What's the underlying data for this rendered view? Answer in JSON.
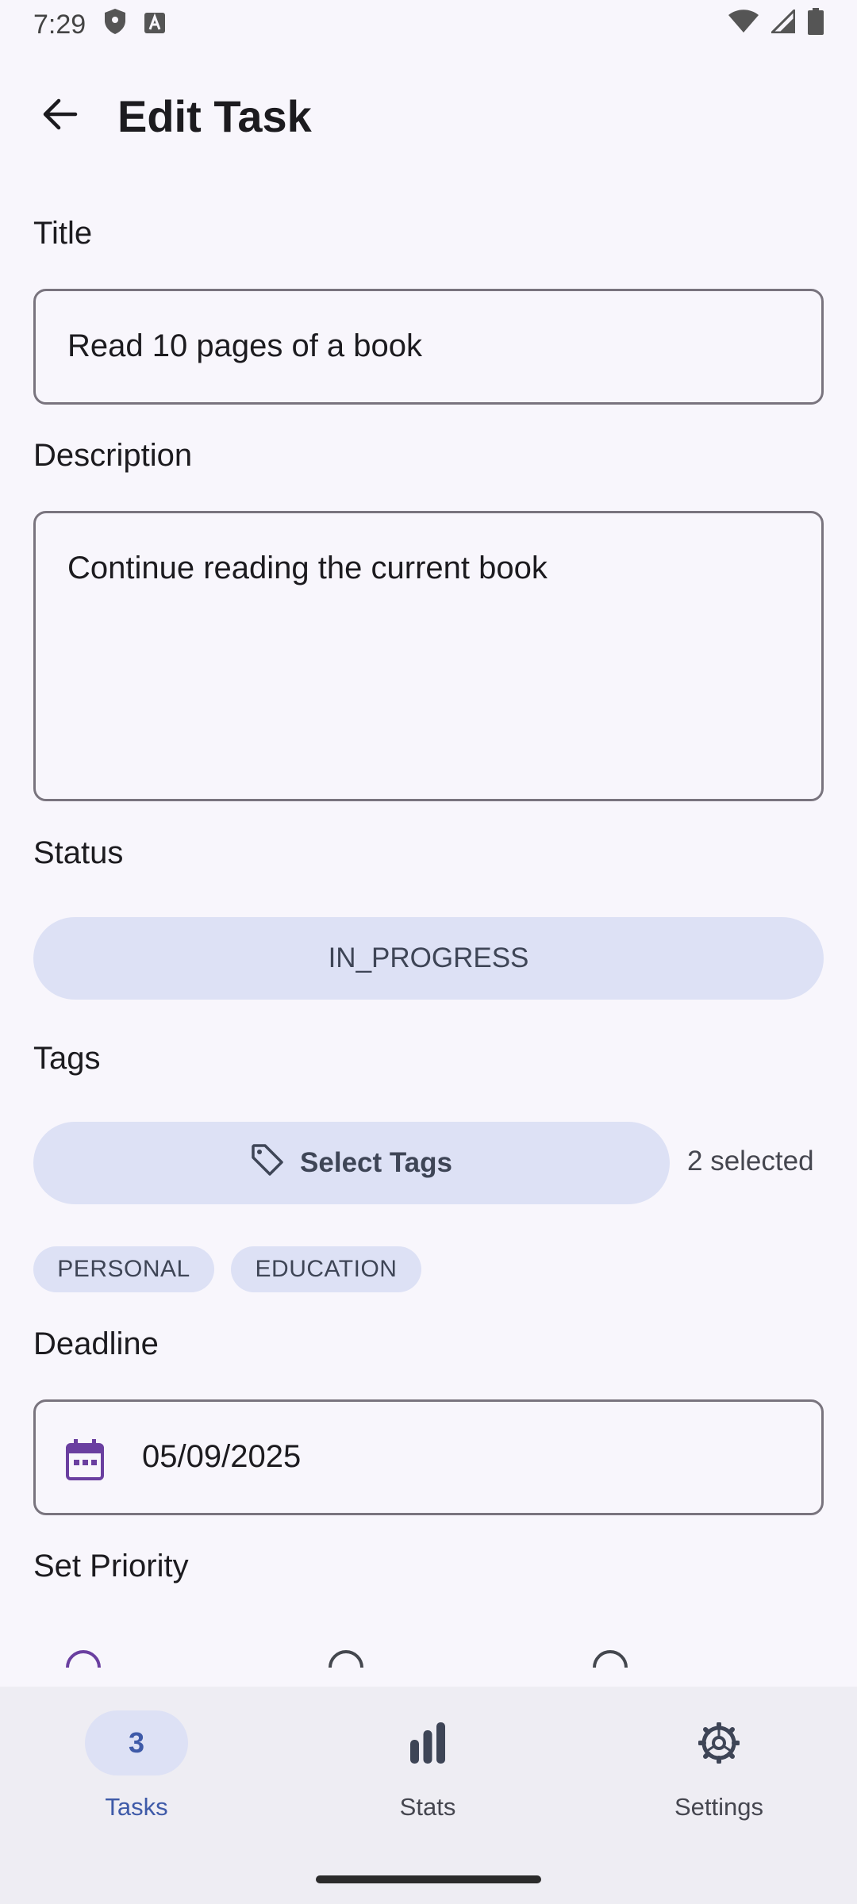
{
  "status_bar": {
    "time": "7:29"
  },
  "app_bar": {
    "title": "Edit Task"
  },
  "form": {
    "title_label": "Title",
    "title_value": "Read 10 pages of a book",
    "description_label": "Description",
    "description_value": "Continue reading the current book",
    "status_label": "Status",
    "status_value": "IN_PROGRESS",
    "tags_label": "Tags",
    "select_tags_label": "Select Tags",
    "tags_selected_count": "2 selected",
    "tags": [
      "PERSONAL",
      "EDUCATION"
    ],
    "deadline_label": "Deadline",
    "deadline_value": "05/09/2025",
    "priority_label": "Set Priority"
  },
  "bottom_nav": {
    "items": [
      {
        "label": "Tasks",
        "badge": "3",
        "active": true
      },
      {
        "label": "Stats",
        "active": false
      },
      {
        "label": "Settings",
        "active": false
      }
    ]
  },
  "colors": {
    "background": "#F8F6FC",
    "tonal_container": "#DDE1F5",
    "accent": "#3E5AA8",
    "calendar_icon": "#6A3FA0",
    "outline": "#79747E",
    "nav_background": "#EEEDF3"
  },
  "icons": {
    "back": "arrow-back-icon",
    "tag": "tag-icon",
    "calendar": "calendar-icon",
    "stats": "bar-chart-icon",
    "settings": "settings-gear-icon",
    "wifi": "wifi-icon",
    "signal": "signal-icon",
    "battery": "battery-icon",
    "shield": "shield-icon",
    "a11y": "font-a-icon"
  }
}
